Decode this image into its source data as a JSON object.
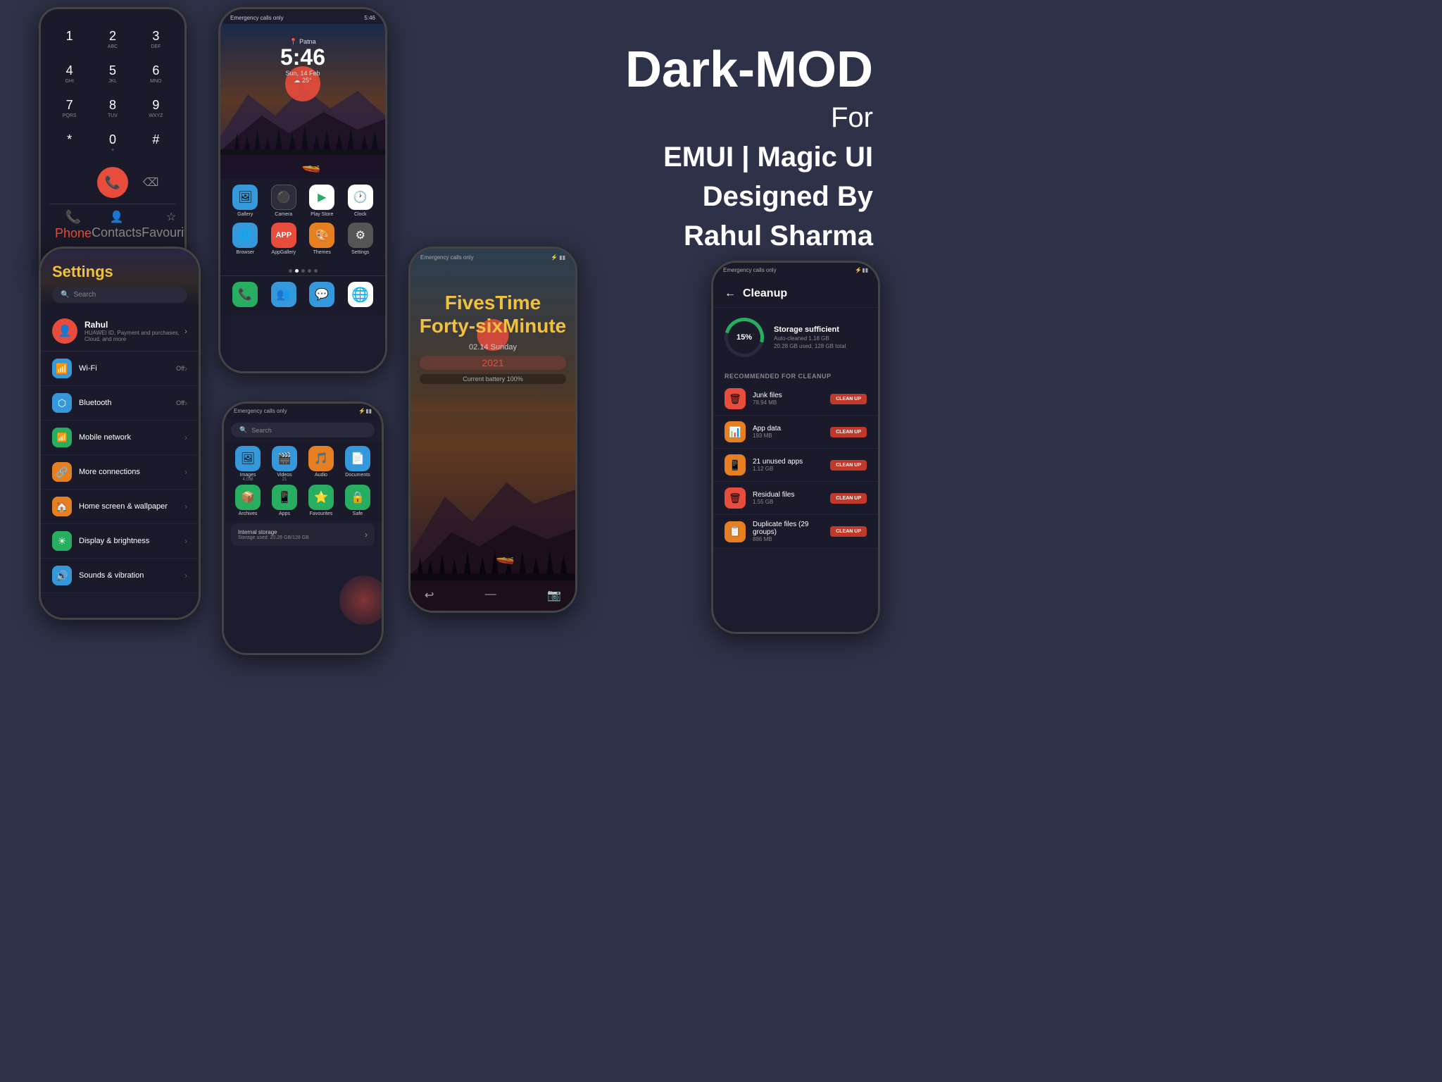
{
  "title": {
    "main": "Dark-MOD",
    "line2": "For",
    "line3": "EMUI | Magic UI",
    "line4": "Designed By",
    "line5": "Rahul Sharma"
  },
  "dialer": {
    "keys": [
      {
        "num": "1",
        "letters": ""
      },
      {
        "num": "2",
        "letters": "ABC"
      },
      {
        "num": "3",
        "letters": "DEF"
      },
      {
        "num": "4",
        "letters": "GHI"
      },
      {
        "num": "5",
        "letters": "JKL"
      },
      {
        "num": "6",
        "letters": "MNO"
      },
      {
        "num": "7",
        "letters": "PQRS"
      },
      {
        "num": "8",
        "letters": "TUV"
      },
      {
        "num": "9",
        "letters": "WXYZ"
      },
      {
        "num": "*",
        "letters": ""
      },
      {
        "num": "0",
        "letters": "+"
      },
      {
        "num": "#",
        "letters": ""
      }
    ],
    "bottom_items": [
      "Phone",
      "Contacts",
      "Favourites"
    ]
  },
  "home": {
    "status_left": "Emergency calls only",
    "status_right": "5:46",
    "clock_city": "Patna",
    "clock_time": "5:46",
    "clock_date": "Sun, 14 Feb",
    "clock_temp": "25°",
    "apps_row1": [
      {
        "label": "Gallery",
        "color": "#3498db"
      },
      {
        "label": "Camera",
        "color": "#2c2c3c"
      },
      {
        "label": "Play Store",
        "color": "#ffffff"
      },
      {
        "label": "Clock",
        "color": "#ffffff"
      }
    ],
    "apps_row2": [
      {
        "label": "Browser",
        "color": "#3498db"
      },
      {
        "label": "AppGallery",
        "color": "#e74c3c"
      },
      {
        "label": "Themes",
        "color": "#e67e22"
      },
      {
        "label": "Settings",
        "color": "#555555"
      }
    ],
    "dock_apps": [
      {
        "label": "Phone"
      },
      {
        "label": "Contacts"
      },
      {
        "label": "Messages"
      },
      {
        "label": "Chrome"
      }
    ]
  },
  "settings": {
    "title": "Settings",
    "search_placeholder": "Search",
    "profile_name": "Rahul",
    "profile_desc": "HUAWEI ID, Payment and purchases, Cloud, and more",
    "items": [
      {
        "label": "Wi-Fi",
        "value": "Off",
        "color": "#3498db"
      },
      {
        "label": "Bluetooth",
        "value": "Off",
        "color": "#3498db"
      },
      {
        "label": "Mobile network",
        "value": "",
        "color": "#27ae60"
      },
      {
        "label": "More connections",
        "value": "",
        "color": "#e67e22"
      },
      {
        "label": "Home screen & wallpaper",
        "value": "",
        "color": "#e67e22"
      },
      {
        "label": "Display & brightness",
        "value": "",
        "color": "#27ae60"
      },
      {
        "label": "Sounds & vibration",
        "value": "",
        "color": "#3498db"
      }
    ]
  },
  "clock_widget": {
    "status_left": "Emergency calls only",
    "time_line1": "FivesTime",
    "time_line2": "Forty-sixMinute",
    "date_line": "02.14 Sunday",
    "year": "2021",
    "battery": "Current battery 100%"
  },
  "files": {
    "status_left": "Emergency calls only",
    "search_placeholder": "Search",
    "categories": [
      {
        "label": "Images",
        "count": "4,038",
        "color": "#3498db"
      },
      {
        "label": "Videos",
        "count": "21",
        "color": "#3498db"
      },
      {
        "label": "Audio",
        "count": "",
        "color": "#e67e22"
      },
      {
        "label": "Documents",
        "count": "",
        "color": "#3498db"
      },
      {
        "label": "Archives",
        "count": "",
        "color": "#27ae60"
      },
      {
        "label": "Apps",
        "count": "",
        "color": "#27ae60"
      },
      {
        "label": "Favourites",
        "count": "",
        "color": "#27ae60"
      },
      {
        "label": "Safe",
        "count": "",
        "color": "#27ae60"
      }
    ],
    "storage_label": "Internal storage",
    "storage_used": "Storage used: 20.28 GB/128 GB"
  },
  "cleanup": {
    "title": "Cleanup",
    "percentage": "15%",
    "status": "Storage sufficient",
    "auto_clean": "Auto-cleaned 1.18 GB",
    "storage_detail": "20.28 GB used, 128 GB total",
    "section_title": "RECOMMENDED FOR CLEANUP",
    "items": [
      {
        "name": "Junk files",
        "size": "78.94 MB",
        "color": "#e74c3c"
      },
      {
        "name": "App data",
        "size": "193 MB",
        "color": "#e67e22"
      },
      {
        "name": "21 unused apps",
        "size": "1.12 GB",
        "color": "#e67e22"
      },
      {
        "name": "Residual files",
        "size": "1.55 GB",
        "color": "#e74c3c"
      },
      {
        "name": "Duplicate files (29 groups)",
        "size": "886 MB",
        "color": "#e67e22"
      }
    ],
    "clean_up_btn": "CLEAN UP"
  }
}
